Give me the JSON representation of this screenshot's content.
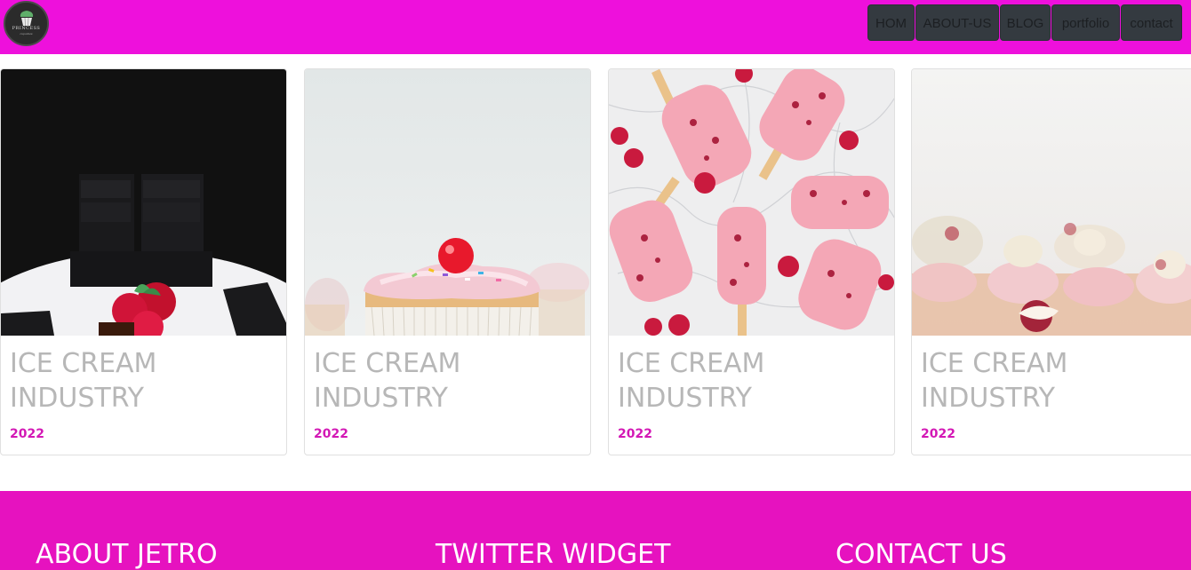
{
  "header": {
    "logo": {
      "name": "PRINCESS",
      "tagline": "cupcakes"
    },
    "nav": [
      {
        "label": "HOM"
      },
      {
        "label": "ABOUT-US"
      },
      {
        "label": "BLOG"
      },
      {
        "label": "portfolio"
      },
      {
        "label": "contact"
      }
    ]
  },
  "cards": [
    {
      "title_line1": "ICE CREAM",
      "title_line2": "INDUSTRY",
      "year": "2022",
      "image": "chocolate-strawberry-dessert"
    },
    {
      "title_line1": "ICE CREAM",
      "title_line2": "INDUSTRY",
      "year": "2022",
      "image": "cupcake-with-cherry"
    },
    {
      "title_line1": "ICE CREAM",
      "title_line2": "INDUSTRY",
      "year": "2022",
      "image": "raspberry-popsicles"
    },
    {
      "title_line1": "ICE CREAM",
      "title_line2": "INDUSTRY",
      "year": "2022",
      "image": "strawberry-cupcakes"
    }
  ],
  "footer": {
    "headings": [
      {
        "label": "ABOUT JETRO"
      },
      {
        "label": "TWITTER WIDGET"
      },
      {
        "label": "CONTACT US"
      }
    ]
  },
  "colors": {
    "header_bg": "#ee10dc",
    "footer_bg": "#e612bf",
    "accent_year": "#d318b5",
    "nav_bg": "#343a40",
    "title_text": "#b7b7b7"
  }
}
